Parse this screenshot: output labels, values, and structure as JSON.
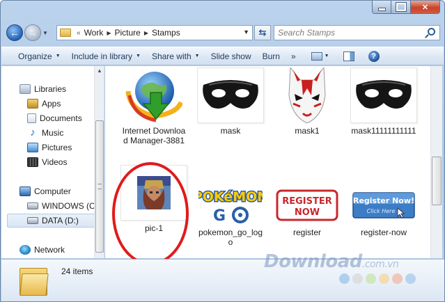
{
  "window": {
    "caption_buttons": [
      "minimize",
      "maximize",
      "close"
    ]
  },
  "address": {
    "overflow_marker": "«",
    "breadcrumbs": [
      "Work",
      "Picture",
      "Stamps"
    ],
    "search_placeholder": "Search Stamps"
  },
  "toolbar": {
    "organize": "Organize",
    "include_in_library": "Include in library",
    "share_with": "Share with",
    "slide_show": "Slide show",
    "burn": "Burn",
    "more": "»"
  },
  "nav": {
    "libraries": "Libraries",
    "apps": "Apps",
    "documents": "Documents",
    "music": "Music",
    "pictures": "Pictures",
    "videos": "Videos",
    "computer": "Computer",
    "windows_drive": "WINDOWS (C:",
    "data_drive": "DATA (D:)",
    "network": "Network"
  },
  "files": [
    {
      "name": "Internet Download Manager-3881",
      "icon": "idm-globe-icon"
    },
    {
      "name": "mask",
      "icon": "black-mask-icon"
    },
    {
      "name": "mask1",
      "icon": "kitsune-mask-icon"
    },
    {
      "name": "mask11111111111",
      "icon": "black-mask-icon"
    },
    {
      "name": "pic-1",
      "icon": "portrait-thumbnail"
    },
    {
      "name": "pokemon_go_logo",
      "icon": "pokemon-go-logo"
    },
    {
      "name": "register",
      "icon": "register-now-stamp"
    },
    {
      "name": "register-now",
      "icon": "register-now-button"
    }
  ],
  "thumb_text": {
    "register_line1": "REGISTER",
    "register_line2": "NOW",
    "register_now_line1": "Register Now!",
    "register_now_line2": "Click Here",
    "pokemon_line1": "POKéMON",
    "pokemon_line2": "GO"
  },
  "details": {
    "item_count": "24 items"
  },
  "watermark": {
    "text": "Download",
    "suffix": ".com.vn"
  },
  "colors": {
    "highlight": "#e01b1b",
    "accent": "#1f63b8"
  }
}
